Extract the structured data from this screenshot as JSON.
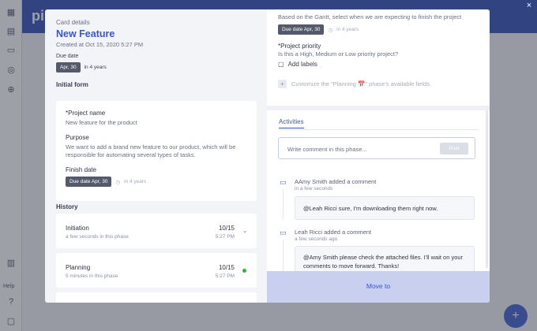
{
  "app": {
    "logo": "pi",
    "colors": {
      "accent": "#3a56c8",
      "topbar": "#3a56b8",
      "fab": "#4a67d6",
      "success_dot": "#2bb34a"
    }
  },
  "sidebar": {
    "icons": [
      "grid-icon",
      "table-icon",
      "inbox-icon",
      "bot-icon",
      "globe-icon",
      "book-icon",
      "help-icon",
      "chat-icon"
    ],
    "help_label": "Help"
  },
  "card": {
    "kicker": "Card details",
    "title": "New Feature",
    "created": "Created at Oct 15, 2020 5:27 PM",
    "due_label": "Due date",
    "due_chip": "Apr, 30",
    "due_relative": "in 4 years"
  },
  "initial_form": {
    "title": "Initial form",
    "project_name_label": "*Project name",
    "project_name_value": "New feature for the product",
    "purpose_label": "Purpose",
    "purpose_value": "We want to add a brand new feature to our product, which will be responsible for automating several types of tasks.",
    "finish_label": "Finish date",
    "finish_chip": "Due date Apr, 30",
    "finish_relative": "in 4 years"
  },
  "history": {
    "title": "History",
    "items": [
      {
        "name": "Initiation",
        "sub": "a few seconds in this phase",
        "date": "10/15",
        "time": "5:27 PM"
      },
      {
        "name": "Planning",
        "sub": "5 minutes in this phase",
        "date": "10/15",
        "time": "5:27 PM"
      }
    ]
  },
  "phase": {
    "finish_question": "Based on the Gantt, select when we are expecting to finish the project",
    "due_chip": "Due date Apr, 30",
    "due_relative": "in 4 years",
    "priority_label": "*Project priority",
    "priority_question": "Is this a High, Medium or Low priority project?",
    "add_labels": "Add labels",
    "customize": "Customize the \"Planning 📅\" phase's available fields."
  },
  "activities": {
    "tab": "Activities",
    "comment_placeholder": "Write comment in this phase...",
    "post_label": "Post",
    "feed": [
      {
        "author": "AAmy Smith added a comment",
        "time": "in a few seconds",
        "text": "@Leah Ricci sure, I'm downloading them right now."
      },
      {
        "author": "Leah Ricci added a comment",
        "time": "a few seconds ago",
        "text": "@Amy Smith please check the attached files. I'll wait on your comments to move forward. Thanks!"
      }
    ]
  },
  "move_to": "Move to",
  "close_label": "×",
  "fab_label": "+"
}
